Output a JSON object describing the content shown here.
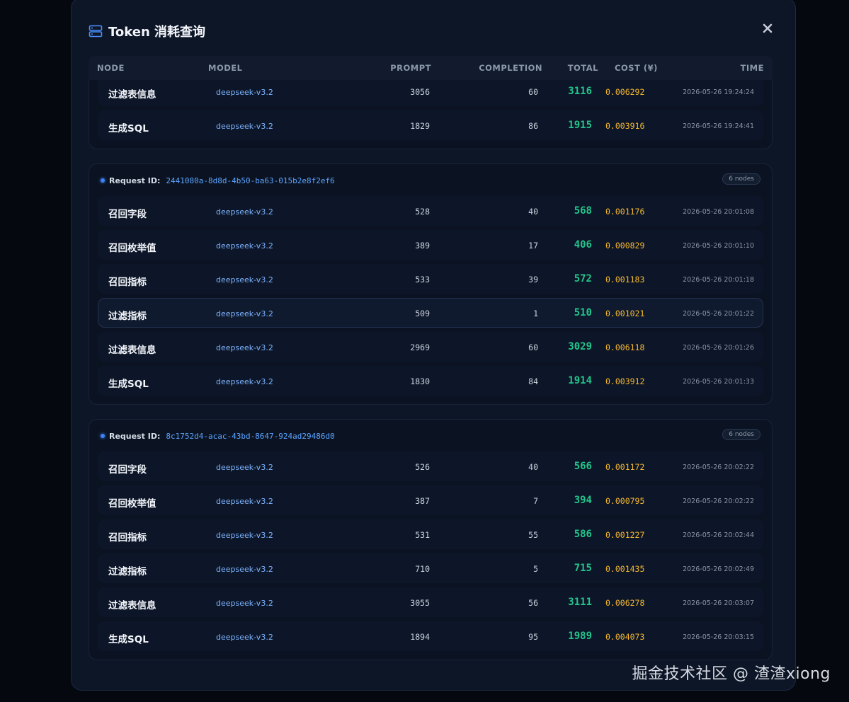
{
  "modal": {
    "title": "Token 消耗查询",
    "close_icon": "close-icon",
    "title_icon": "server-icon"
  },
  "columns": {
    "node": "NODE",
    "model": "MODEL",
    "prompt": "PROMPT",
    "completion": "COMPLETION",
    "total": "TOTAL",
    "cost": "COST (¥)",
    "time": "TIME"
  },
  "groups": [
    {
      "rows": [
        {
          "node": "过滤表信息",
          "model": "deepseek-v3.2",
          "prompt": "3056",
          "completion": "60",
          "total": "3116",
          "cost": "0.006292",
          "time": "2026-05-26 19:24:24"
        },
        {
          "node": "生成SQL",
          "model": "deepseek-v3.2",
          "prompt": "1829",
          "completion": "86",
          "total": "1915",
          "cost": "0.003916",
          "time": "2026-05-26 19:24:41"
        }
      ]
    },
    {
      "request_label": "Request ID:",
      "request_id": "2441080a-8d8d-4b50-ba63-015b2e8f2ef6",
      "badge": "6 nodes",
      "rows": [
        {
          "node": "召回字段",
          "model": "deepseek-v3.2",
          "prompt": "528",
          "completion": "40",
          "total": "568",
          "cost": "0.001176",
          "time": "2026-05-26 20:01:08"
        },
        {
          "node": "召回枚举值",
          "model": "deepseek-v3.2",
          "prompt": "389",
          "completion": "17",
          "total": "406",
          "cost": "0.000829",
          "time": "2026-05-26 20:01:10"
        },
        {
          "node": "召回指标",
          "model": "deepseek-v3.2",
          "prompt": "533",
          "completion": "39",
          "total": "572",
          "cost": "0.001183",
          "time": "2026-05-26 20:01:18"
        },
        {
          "node": "过滤指标",
          "model": "deepseek-v3.2",
          "prompt": "509",
          "completion": "1",
          "total": "510",
          "cost": "0.001021",
          "time": "2026-05-26 20:01:22"
        },
        {
          "node": "过滤表信息",
          "model": "deepseek-v3.2",
          "prompt": "2969",
          "completion": "60",
          "total": "3029",
          "cost": "0.006118",
          "time": "2026-05-26 20:01:26"
        },
        {
          "node": "生成SQL",
          "model": "deepseek-v3.2",
          "prompt": "1830",
          "completion": "84",
          "total": "1914",
          "cost": "0.003912",
          "time": "2026-05-26 20:01:33"
        }
      ]
    },
    {
      "request_label": "Request ID:",
      "request_id": "8c1752d4-acac-43bd-8647-924ad29486d0",
      "badge": "6 nodes",
      "rows": [
        {
          "node": "召回字段",
          "model": "deepseek-v3.2",
          "prompt": "526",
          "completion": "40",
          "total": "566",
          "cost": "0.001172",
          "time": "2026-05-26 20:02:22"
        },
        {
          "node": "召回枚举值",
          "model": "deepseek-v3.2",
          "prompt": "387",
          "completion": "7",
          "total": "394",
          "cost": "0.000795",
          "time": "2026-05-26 20:02:22"
        },
        {
          "node": "召回指标",
          "model": "deepseek-v3.2",
          "prompt": "531",
          "completion": "55",
          "total": "586",
          "cost": "0.001227",
          "time": "2026-05-26 20:02:44"
        },
        {
          "node": "过滤指标",
          "model": "deepseek-v3.2",
          "prompt": "710",
          "completion": "5",
          "total": "715",
          "cost": "0.001435",
          "time": "2026-05-26 20:02:49"
        },
        {
          "node": "过滤表信息",
          "model": "deepseek-v3.2",
          "prompt": "3055",
          "completion": "56",
          "total": "3111",
          "cost": "0.006278",
          "time": "2026-05-26 20:03:07"
        },
        {
          "node": "生成SQL",
          "model": "deepseek-v3.2",
          "prompt": "1894",
          "completion": "95",
          "total": "1989",
          "cost": "0.004073",
          "time": "2026-05-26 20:03:15"
        }
      ]
    }
  ],
  "watermark": "掘金技术社区 @ 渣渣xiong",
  "colors": {
    "total": "#22c58b",
    "cost": "#f5b82e",
    "model": "#7cb3ff",
    "accent": "#3b82f6"
  }
}
